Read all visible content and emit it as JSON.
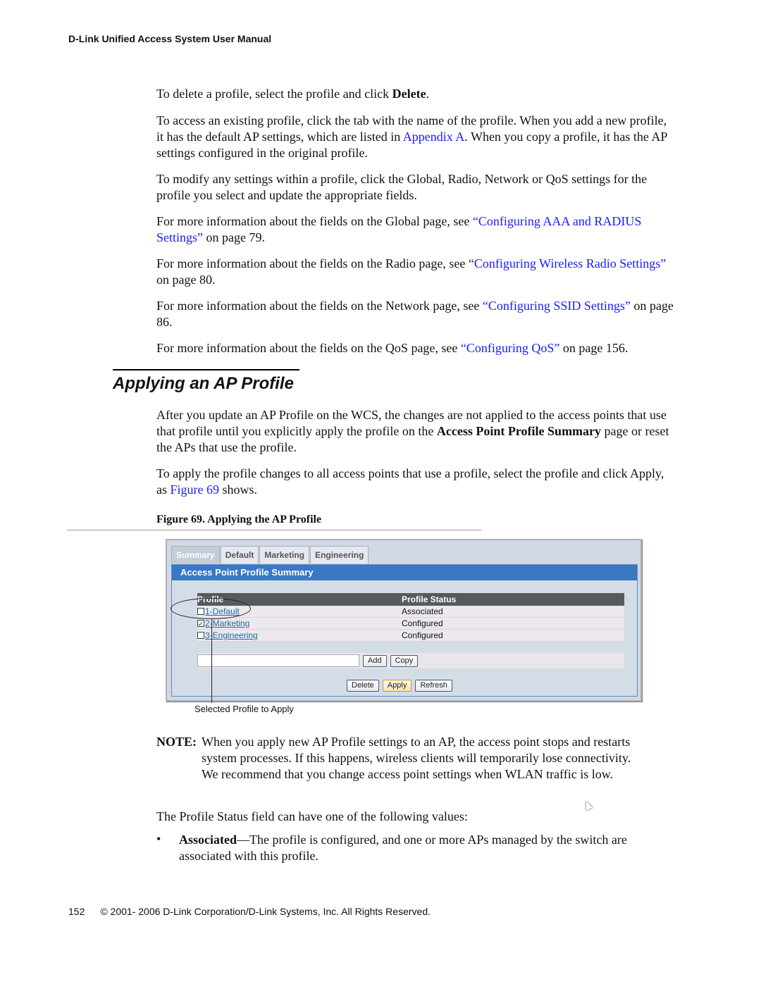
{
  "header": {
    "title": "D-Link Unified Access System User Manual"
  },
  "intro": {
    "p1": {
      "pre": "To delete a profile, select the profile and click ",
      "bold": "Delete",
      "post": "."
    },
    "p2": {
      "pre": "To access an existing profile, click the tab with the name of the profile. When you add a new profile, it has the default AP settings, which are listed in ",
      "link": "Appendix A",
      "post": ". When you copy a profile, it has the AP settings configured in the original profile."
    },
    "p3": "To modify any settings within a profile, click the Global, Radio, Network or QoS settings for the profile you select and update the appropriate fields.",
    "p4": {
      "pre": "For more information about the fields on the Global page, see ",
      "link": "“Configuring AAA and RADIUS Settings”",
      "post": " on page 79."
    },
    "p5": {
      "pre": "For more information about the fields on the Radio page, see ",
      "link": "“Configuring Wireless Radio Settings”",
      "post": " on page 80."
    },
    "p6": {
      "pre": "For more information about the fields on the Network page, see ",
      "link": "“Configuring SSID Settings”",
      "post": " on page 86."
    },
    "p7": {
      "pre": "For more information about the fields on the QoS page, see ",
      "link": "“Configuring QoS”",
      "post": " on page 156."
    }
  },
  "section": {
    "title": "Applying an AP Profile",
    "p1": {
      "pre": "After you update an AP Profile on the WCS, the changes are not applied to the access points that use that profile until you explicitly apply the profile on the ",
      "bold1": "Access Point Profile Summary",
      "post": " page or reset the APs that use the profile."
    },
    "p2": {
      "pre": "To apply the profile changes to all access points that use a profile, select the profile and click Apply, as ",
      "link": "Figure 69",
      "post": " shows."
    }
  },
  "figure": {
    "caption": "Figure 69.  Applying the AP Profile",
    "tabs": [
      "Summary",
      "Default",
      "Marketing",
      "Engineering"
    ],
    "active_tab": "Summary",
    "panel_title": "Access Point Profile Summary",
    "columns": [
      "Profile",
      "Profile Status"
    ],
    "rows": [
      {
        "profile": "1-Default",
        "status": "Associated",
        "checked": false
      },
      {
        "profile": "2-Marketing",
        "status": "Configured",
        "checked": true
      },
      {
        "profile": "3-Engineering",
        "status": "Configured",
        "checked": false
      }
    ],
    "new_profile_input": {
      "value": "",
      "placeholder": ""
    },
    "buttons": {
      "add": "Add",
      "copy": "Copy",
      "delete": "Delete",
      "apply": "Apply",
      "refresh": "Refresh"
    },
    "callout": "Selected Profile to Apply"
  },
  "note": {
    "label": "NOTE:",
    "text": "When you apply new AP Profile settings to an AP, the access point stops and restarts system processes. If this happens, wireless clients will temporarily lose connectivity. We recommend that you change access point settings when WLAN traffic is low."
  },
  "status_intro": "The Profile Status field can have one of the following values:",
  "bullets": [
    {
      "marker": "•",
      "term": "Associated",
      "text": "—The profile is configured, and one or more APs managed by the switch are associated with this profile."
    }
  ],
  "footer": {
    "page": "152",
    "copyright": "© 2001- 2006 D-Link Corporation/D-Link Systems, Inc. All Rights Reserved."
  },
  "colors": {
    "link": "#1a1aff",
    "panel_header": "#3a78c4",
    "table_header": "#555a5e",
    "profile_link": "#1e6e9e"
  }
}
